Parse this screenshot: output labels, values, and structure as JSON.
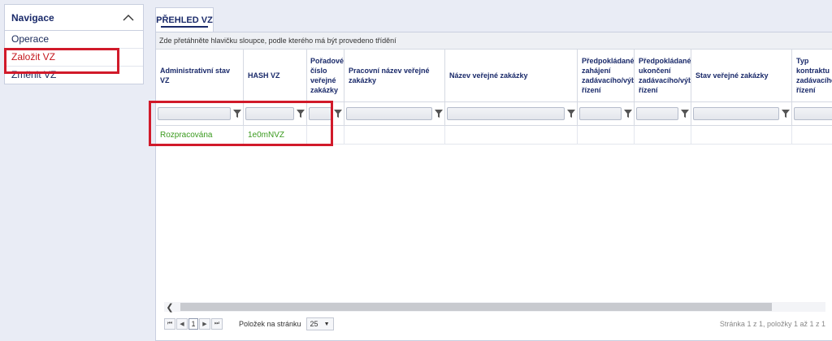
{
  "navigation": {
    "title": "Navigace",
    "items": [
      {
        "label": "Operace"
      },
      {
        "label": "Založit VZ"
      },
      {
        "label": "Změnit VZ"
      }
    ]
  },
  "tab": {
    "label": "PŘEHLED VZ"
  },
  "grid": {
    "group_hint": "Zde přetáhněte hlavičku sloupce, podle kterého má být provedeno třídění",
    "columns": [
      "Administrativní stav VZ",
      "HASH VZ",
      "Pořadové číslo veřejné zakázky",
      "Pracovní název veřejné zakázky",
      "Název veřejné zakázky",
      "Předpokládané datum zahájení zadávacího/výběrového řízení",
      "Předpokládané datum ukončení zadávacího/výběrového řízení",
      "Stav veřejné zakázky",
      "Typ kontraktu zadávacího řízení"
    ],
    "rows": [
      [
        "Rozpracována",
        "1e0mNVZ",
        "",
        "",
        "",
        "",
        "",
        "",
        ""
      ]
    ]
  },
  "pager": {
    "current_page": "1",
    "per_page_label": "Položek na stránku",
    "per_page_value": "25",
    "info": "Stránka 1 z 1, položky 1 až 1 z 1"
  },
  "colors": {
    "accent": "#1a2a6a",
    "highlight_box": "#d11a2a",
    "status_green": "#3a9a1e"
  },
  "icons": {
    "collapse": "chevron-up-icon",
    "filter": "funnel-icon",
    "pager_first": "first-page-icon",
    "pager_prev": "prev-page-icon",
    "pager_next": "next-page-icon",
    "pager_last": "last-page-icon"
  }
}
